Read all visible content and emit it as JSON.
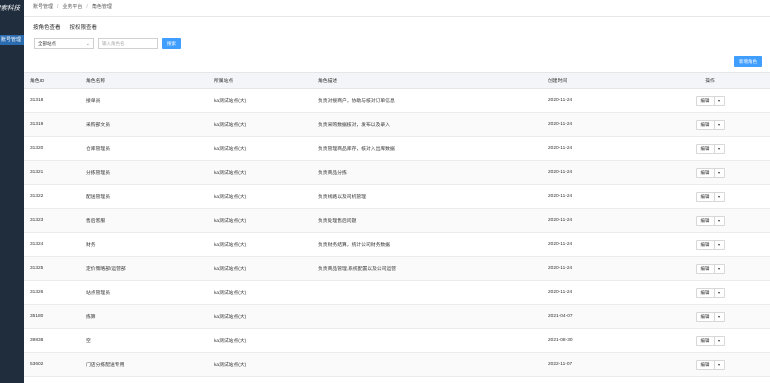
{
  "sidebar": {
    "brand": "搜索科技",
    "active_item": "账号管理"
  },
  "breadcrumb": [
    "账号管理",
    "业务平台",
    "角色管理"
  ],
  "tabs": [
    {
      "label": "按角色查看"
    },
    {
      "label": "按权限查看"
    }
  ],
  "filters": {
    "select_value": "全部站点",
    "input_placeholder": "输入角色名",
    "search_label": "搜索"
  },
  "add_button_label": "新增角色",
  "columns": [
    "角色ID",
    "角色名称",
    "所属站点",
    "角色描述",
    "创建时间",
    "操作"
  ],
  "rows": [
    {
      "id": "31318",
      "name": "接单员",
      "site": "ka测试站点(大)",
      "desc": "负责对接商户，协助与核对订单信息",
      "created": "2020-11-24"
    },
    {
      "id": "31319",
      "name": "采购部文员",
      "site": "ka测试站点(大)",
      "desc": "负责采购数据核对，发布以及录入",
      "created": "2020-11-24"
    },
    {
      "id": "31320",
      "name": "仓库管理员",
      "site": "ka测试站点(大)",
      "desc": "负责管理商品库存，核对入出库数据",
      "created": "2020-11-24"
    },
    {
      "id": "31321",
      "name": "分拣管理员",
      "site": "ka测试站点(大)",
      "desc": "负责商品分拣",
      "created": "2020-11-24"
    },
    {
      "id": "31322",
      "name": "配送管理员",
      "site": "ka测试站点(大)",
      "desc": "负责线路以及司机管理",
      "created": "2020-11-24"
    },
    {
      "id": "31323",
      "name": "售后客服",
      "site": "ka测试站点(大)",
      "desc": "负责处理售后问题",
      "created": "2020-11-24"
    },
    {
      "id": "31324",
      "name": "财务",
      "site": "ka测试站点(大)",
      "desc": "负责财务结算，统计公司财务数据",
      "created": "2020-11-24"
    },
    {
      "id": "31325",
      "name": "定价策略部/运营部",
      "site": "ka测试站点(大)",
      "desc": "负责商品管理,系统配置以及公司运营",
      "created": "2020-11-24"
    },
    {
      "id": "31326",
      "name": "站点管理员",
      "site": "ka测试站点(大)",
      "desc": "",
      "created": "2020-11-24"
    },
    {
      "id": "35180",
      "name": "拣算",
      "site": "ka测试站点(大)",
      "desc": "",
      "created": "2021-04-07"
    },
    {
      "id": "39838",
      "name": "空",
      "site": "ka测试站点(大)",
      "desc": "",
      "created": "2021-08-30"
    },
    {
      "id": "53602",
      "name": "门店分拣配送专用",
      "site": "ka测试站点(大)",
      "desc": "",
      "created": "2022-11-07"
    }
  ],
  "row_actions": {
    "edit_label": "编辑",
    "more_icon": "▾"
  },
  "colors": {
    "sidebar_bg": "#1f2d3d",
    "sidebar_active": "#2b6cb0",
    "primary": "#409eff"
  }
}
